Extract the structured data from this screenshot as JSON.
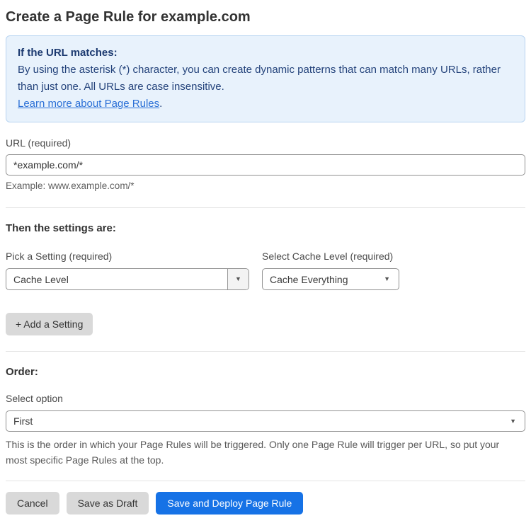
{
  "page": {
    "title": "Create a Page Rule for example.com"
  },
  "info_box": {
    "heading": "If the URL matches:",
    "body": "By using the asterisk (*) character, you can create dynamic patterns that can match many URLs, rather than just one. All URLs are case insensitive.",
    "link_text": "Learn more about Page Rules",
    "link_suffix": "."
  },
  "url_field": {
    "label": "URL (required)",
    "value": "*example.com/*",
    "helper": "Example: www.example.com/*"
  },
  "settings_section": {
    "heading": "Then the settings are:",
    "pick_setting": {
      "label": "Pick a Setting (required)",
      "selected": "Cache Level"
    },
    "cache_level": {
      "label": "Select Cache Level (required)",
      "selected": "Cache Everything"
    },
    "add_setting_label": "+ Add a Setting"
  },
  "order_section": {
    "heading": "Order:",
    "label": "Select option",
    "selected": "First",
    "helper": "This is the order in which your Page Rules will be triggered. Only one Page Rule will trigger per URL, so put your most specific Page Rules at the top."
  },
  "footer": {
    "cancel_label": "Cancel",
    "save_draft_label": "Save as Draft",
    "save_deploy_label": "Save and Deploy Page Rule"
  },
  "icons": {
    "dropdown_arrow": "▼"
  },
  "colors": {
    "info_box_bg": "#e8f2fc",
    "info_box_border": "#b8d4f1",
    "info_text": "#1f3f77",
    "link_blue": "#2a6fd6",
    "primary_button_blue": "#1672e6",
    "gray_button_bg": "#d9d9d9",
    "input_border": "#919191"
  }
}
